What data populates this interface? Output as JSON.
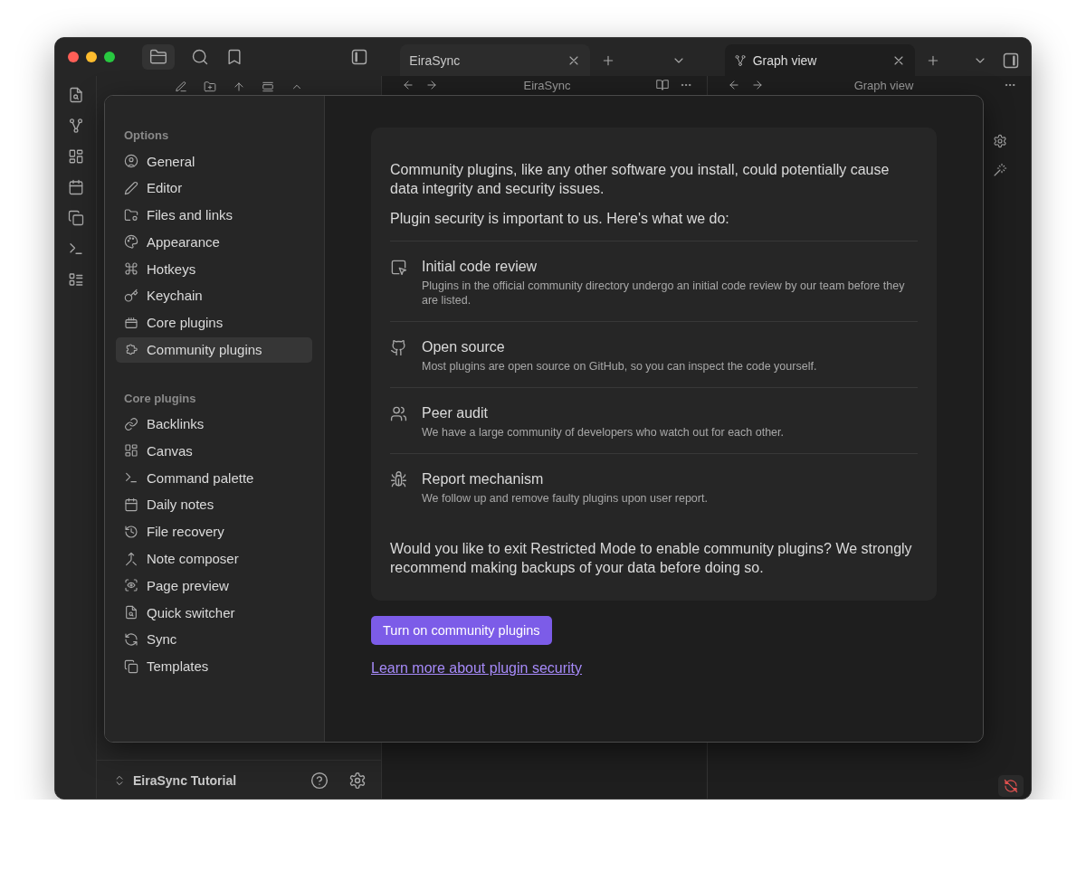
{
  "tab_groups": [
    {
      "tabs": [
        {
          "label": "EiraSync",
          "selected": false
        }
      ]
    },
    {
      "tabs": [
        {
          "label": "Graph view",
          "selected": true
        }
      ]
    }
  ],
  "panes": [
    {
      "title": "EiraSync"
    },
    {
      "title": "Graph view"
    }
  ],
  "vault": {
    "name": "EiraSync Tutorial"
  },
  "settings": {
    "sections": [
      {
        "heading": "Options",
        "items": [
          {
            "label": "General",
            "selected": false
          },
          {
            "label": "Editor",
            "selected": false
          },
          {
            "label": "Files and links",
            "selected": false
          },
          {
            "label": "Appearance",
            "selected": false
          },
          {
            "label": "Hotkeys",
            "selected": false
          },
          {
            "label": "Keychain",
            "selected": false
          },
          {
            "label": "Core plugins",
            "selected": false
          },
          {
            "label": "Community plugins",
            "selected": true
          }
        ]
      },
      {
        "heading": "Core plugins",
        "items": [
          {
            "label": "Backlinks",
            "selected": false
          },
          {
            "label": "Canvas",
            "selected": false
          },
          {
            "label": "Command palette",
            "selected": false
          },
          {
            "label": "Daily notes",
            "selected": false
          },
          {
            "label": "File recovery",
            "selected": false
          },
          {
            "label": "Note composer",
            "selected": false
          },
          {
            "label": "Page preview",
            "selected": false
          },
          {
            "label": "Quick switcher",
            "selected": false
          },
          {
            "label": "Sync",
            "selected": false
          },
          {
            "label": "Templates",
            "selected": false
          }
        ]
      }
    ]
  },
  "notice": {
    "intro": [
      "Community plugins, like any other software you install, could potentially cause data integrity and security issues.",
      "Plugin security is important to us. Here's what we do:"
    ],
    "features": [
      {
        "title": "Initial code review",
        "description": "Plugins in the official community directory undergo an initial code review by our team before they are listed."
      },
      {
        "title": "Open source",
        "description": "Most plugins are open source on GitHub, so you can inspect the code yourself."
      },
      {
        "title": "Peer audit",
        "description": "We have a large community of developers who watch out for each other."
      },
      {
        "title": "Report mechanism",
        "description": "We follow up and remove faulty plugins upon user report."
      }
    ],
    "question": "Would you like to exit Restricted Mode to enable community plugins? We strongly recommend making backups of your data before doing so."
  },
  "primary_button": "Turn on community plugins",
  "link": "Learn more about plugin security"
}
